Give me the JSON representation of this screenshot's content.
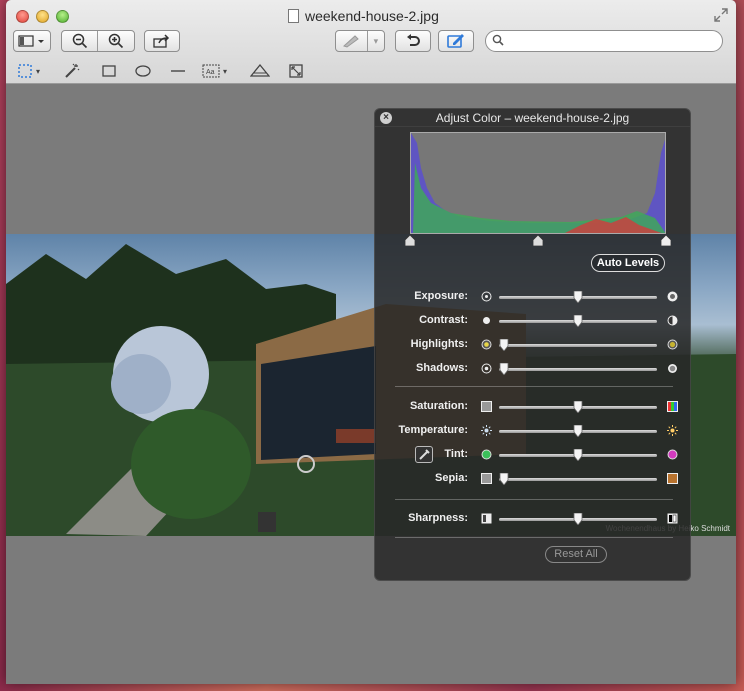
{
  "window": {
    "title": "weekend-house-2.jpg"
  },
  "toolbar": {
    "view_mode": "view-mode-menu",
    "zoom_out": "zoom-out",
    "zoom_in": "zoom-in",
    "share": "share",
    "rotate": "rotate-left",
    "annotate": "annotate",
    "search_placeholder": ""
  },
  "photo": {
    "credit": "Wochenendhaus by Heiko Schmidt"
  },
  "adjust": {
    "title": "Adjust Color – weekend-house-2.jpg",
    "auto_levels": "Auto Levels",
    "reset_all": "Reset All",
    "levels": [
      0.0,
      0.5,
      1.0
    ],
    "sliders": [
      {
        "label": "Exposure:",
        "value": 0.5
      },
      {
        "label": "Contrast:",
        "value": 0.5
      },
      {
        "label": "Highlights:",
        "value": 0.03
      },
      {
        "label": "Shadows:",
        "value": 0.03
      },
      {
        "label": "Saturation:",
        "value": 0.5
      },
      {
        "label": "Temperature:",
        "value": 0.5
      },
      {
        "label": "Tint:",
        "value": 0.5
      },
      {
        "label": "Sepia:",
        "value": 0.03
      },
      {
        "label": "Sharpness:",
        "value": 0.5
      }
    ]
  },
  "colors": {
    "accent": "#2f7ad9"
  }
}
